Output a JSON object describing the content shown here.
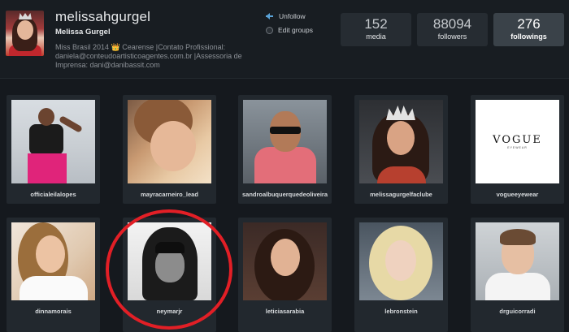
{
  "profile": {
    "username": "melissahgurgel",
    "full_name": "Melissa Gurgel",
    "bio": "Miss Brasil 2014 👑 Cearense |Contato Profissional: daniela@conteudoartisticoagentes.com.br |Assessoria de Imprensa: dani@danibassit.com"
  },
  "actions": {
    "unfollow_label": "Unfollow",
    "edit_groups_label": "Edit groups"
  },
  "stats": {
    "media": {
      "value": "152",
      "label": "media"
    },
    "followers": {
      "value": "88094",
      "label": "followers"
    },
    "followings": {
      "value": "276",
      "label": "followings"
    }
  },
  "grid": {
    "row1": [
      "officialeilalopes",
      "mayracarneiro_lead",
      "sandroalbuquerquedeoliveira",
      "melissagurgelfaclube",
      "vogueeyewear"
    ],
    "row2": [
      "dinnamorais",
      "neymarjr",
      "leticiasarabia",
      "lebronstein",
      "drguicorradi"
    ]
  },
  "vogue_logo": {
    "text": "VOGUE",
    "sub": "EYEWEAR"
  },
  "colors": {
    "background": "#15191e",
    "card": "#22282e",
    "accent": "#5aa3d8",
    "highlight": "#e21f26"
  },
  "icons": {
    "unfollow": "arrow-left-icon",
    "edit_groups": "radio-icon"
  }
}
